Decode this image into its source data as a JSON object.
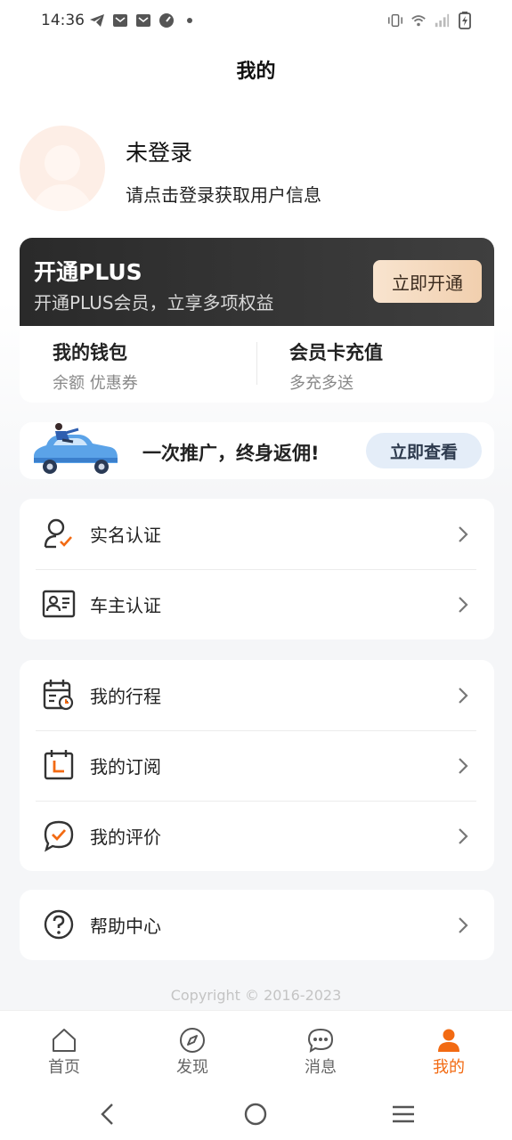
{
  "status_bar": {
    "time": "14:36",
    "left_icons": [
      "telegram-icon",
      "mail-icon",
      "mail-icon",
      "speedometer-icon",
      "dot-icon"
    ],
    "right_icons": [
      "vibrate-icon",
      "wifi-icon",
      "signal-icon",
      "battery-charging-icon"
    ]
  },
  "header": {
    "title": "我的"
  },
  "profile": {
    "name": "未登录",
    "hint": "请点击登录获取用户信息",
    "avatar_icon": "user-avatar-icon"
  },
  "plus": {
    "title": "开通PLUS",
    "subtitle": "开通PLUS会员，立享多项权益",
    "button": "立即开通"
  },
  "wallet": {
    "left": {
      "title": "我的钱包",
      "subtitle": "余额 优惠券"
    },
    "right": {
      "title": "会员卡充值",
      "subtitle": "多充多送"
    }
  },
  "promo": {
    "text": "一次推广，终身返佣!",
    "button": "立即查看"
  },
  "menu_group_1": [
    {
      "label": "实名认证",
      "icon": "user-verified-icon"
    },
    {
      "label": "车主认证",
      "icon": "id-card-icon"
    }
  ],
  "menu_group_2": [
    {
      "label": "我的行程",
      "icon": "calendar-clock-icon"
    },
    {
      "label": "我的订阅",
      "icon": "subscription-icon"
    },
    {
      "label": "我的评价",
      "icon": "review-check-icon"
    }
  ],
  "menu_group_3": [
    {
      "label": "帮助中心",
      "icon": "help-circle-icon"
    }
  ],
  "copyright": "Copyright © 2016-2023",
  "tabs": [
    {
      "label": "首页",
      "icon": "home-icon",
      "active": false
    },
    {
      "label": "发现",
      "icon": "compass-icon",
      "active": false
    },
    {
      "label": "消息",
      "icon": "message-icon",
      "active": false
    },
    {
      "label": "我的",
      "icon": "person-icon",
      "active": true
    }
  ],
  "colors": {
    "accent": "#f26a12",
    "plus_dark": "#2a2a2a",
    "plus_gold": "#f1cfae",
    "background": "#f5f6f8"
  }
}
